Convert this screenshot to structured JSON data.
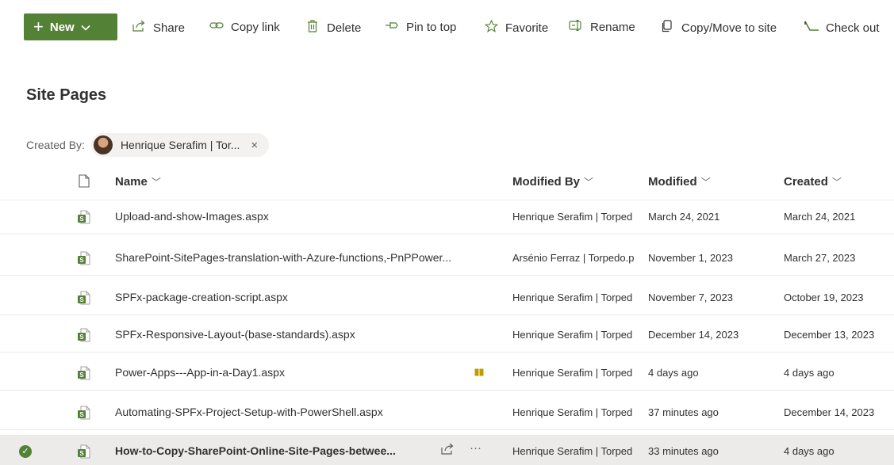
{
  "colors": {
    "accent": "#538135",
    "selected_row": "#edebe9",
    "pill": "#f3f2f1"
  },
  "commandbar": {
    "new": {
      "label": "New",
      "icon": "plus-icon"
    },
    "items": [
      {
        "label": "Share",
        "icon": "share-icon"
      },
      {
        "label": "Copy link",
        "icon": "link-icon"
      },
      {
        "label": "Delete",
        "icon": "trash-icon"
      },
      {
        "label": "Pin to top",
        "icon": "pin-icon"
      },
      {
        "label": "Favorite",
        "icon": "star-icon"
      },
      {
        "label": "Rename",
        "icon": "rename-icon"
      },
      {
        "label": "Copy/Move to site",
        "icon": "copy-icon"
      },
      {
        "label": "Check out",
        "icon": "checkout-icon"
      }
    ]
  },
  "page": {
    "title": "Site Pages"
  },
  "filter": {
    "label": "Created By:",
    "value": "Henrique Serafim | Tor...",
    "remove_glyph": "×"
  },
  "columns": [
    {
      "label": "Name"
    },
    {
      "label": "Modified By"
    },
    {
      "label": "Modified"
    },
    {
      "label": "Created"
    }
  ],
  "rows": [
    {
      "name": "Upload-and-show-Images.aspx",
      "modified_by": "Henrique Serafim | Torped",
      "modified": "March 24, 2021",
      "created": "March 24, 2021"
    },
    {
      "name": "SharePoint-SitePages-translation-with-Azure-functions,-PnPPower...",
      "modified_by": "Arsénio Ferraz | Torpedo.p",
      "modified": "November 1, 2023",
      "created": "March 27, 2023"
    },
    {
      "name": "SPFx-package-creation-script.aspx",
      "modified_by": "Henrique Serafim | Torped",
      "modified": "November 7, 2023",
      "created": "October 19, 2023"
    },
    {
      "name": "SPFx-Responsive-Layout-(base-standards).aspx",
      "modified_by": "Henrique Serafim | Torped",
      "modified": "December 14, 2023",
      "created": "December 13, 2023"
    },
    {
      "name": "Power-Apps---App-in-a-Day1.aspx",
      "modified_by": "Henrique Serafim | Torped",
      "modified": "4 days ago",
      "created": "4 days ago",
      "badge": "book-icon"
    },
    {
      "name": "Automating-SPFx-Project-Setup-with-PowerShell.aspx",
      "modified_by": "Henrique Serafim | Torped",
      "modified": "37 minutes ago",
      "created": "December 14, 2023"
    },
    {
      "name": "How-to-Copy-SharePoint-Online-Site-Pages-betwee...",
      "modified_by": "Henrique Serafim | Torped",
      "modified": "33 minutes ago",
      "created": "4 days ago",
      "selected": true,
      "more_glyph": "···"
    }
  ]
}
